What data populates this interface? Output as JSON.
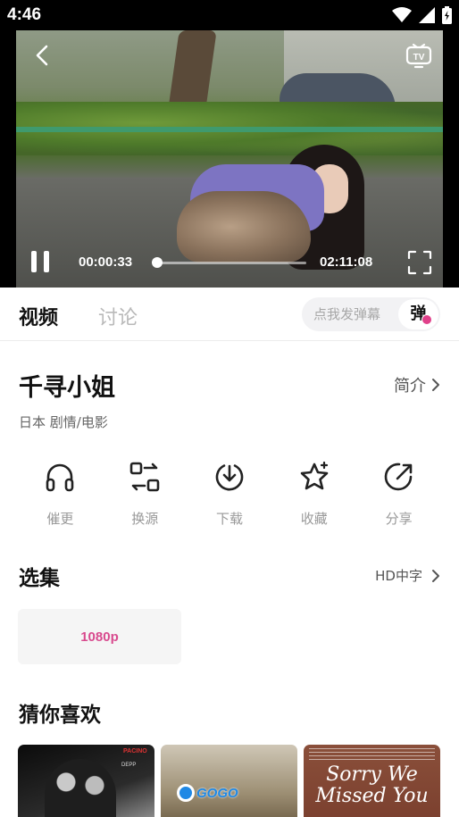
{
  "status_bar": {
    "time": "4:46"
  },
  "player": {
    "current_time": "00:00:33",
    "total_time": "02:11:08",
    "progress_fraction": 0.004
  },
  "tabs": [
    {
      "label": "视频",
      "active": true
    },
    {
      "label": "讨论",
      "active": false
    }
  ],
  "danmaku": {
    "placeholder": "点我发弹幕",
    "button_label": "弹"
  },
  "movie": {
    "title": "千寻小姐",
    "intro_label": "简介",
    "meta": "日本  剧情/电影"
  },
  "actions": [
    {
      "label": "催更",
      "icon": "headphones-icon"
    },
    {
      "label": "换源",
      "icon": "switch-source-icon"
    },
    {
      "label": "下载",
      "icon": "download-icon"
    },
    {
      "label": "收藏",
      "icon": "star-icon"
    },
    {
      "label": "分享",
      "icon": "share-icon"
    }
  ],
  "episodes": {
    "title": "选集",
    "more_label": "HD中字",
    "items": [
      "1080p"
    ]
  },
  "recommend": {
    "title": "猜你喜欢",
    "posters": [
      {
        "text_1": "PACINO",
        "text_2": "DEPP"
      },
      {
        "logo_text": "GOGO"
      },
      {
        "title": "Sorry We Missed You"
      }
    ]
  },
  "colors": {
    "accent": "#d84a8e",
    "text_primary": "#111111",
    "text_muted": "#999999"
  }
}
